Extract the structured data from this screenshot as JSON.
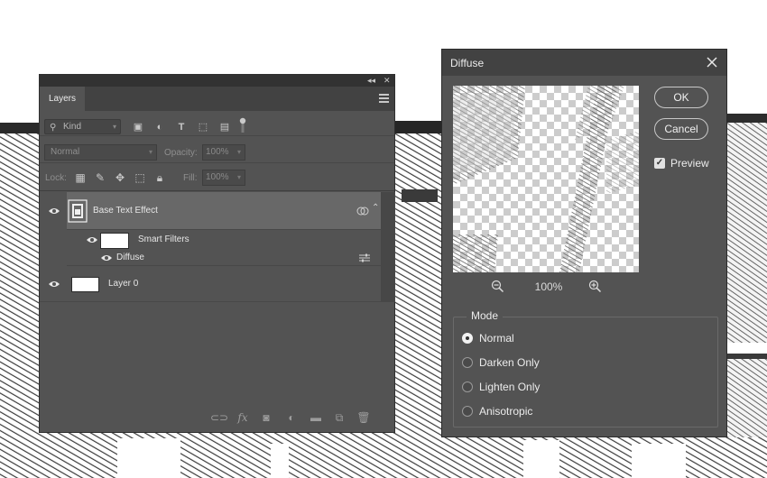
{
  "colors": {
    "panel_bg": "#535353",
    "panel_dark": "#424242",
    "selected_row": "#686868",
    "text": "#e6e6e6",
    "muted": "#8e8e8e"
  },
  "layers_panel": {
    "tab_label": "Layers",
    "filter": {
      "kind_label": "Kind",
      "icons": [
        "image-filter-icon",
        "adjustment-filter-icon",
        "type-filter-icon",
        "shape-filter-icon",
        "smart-object-filter-icon"
      ]
    },
    "blend_mode": "Normal",
    "opacity_label": "Opacity:",
    "opacity_value": "100%",
    "lock_label": "Lock:",
    "fill_label": "Fill:",
    "fill_value": "100%",
    "layers": [
      {
        "name": "Base Text Effect",
        "type": "smart-object",
        "selected": true,
        "filters_label": "Smart Filters",
        "filters": [
          {
            "name": "Diffuse"
          }
        ]
      },
      {
        "name": "Layer 0",
        "type": "normal",
        "selected": false
      }
    ],
    "bottom_icons": [
      "link-icon",
      "fx-icon",
      "mask-icon",
      "adjustment-icon",
      "folder-icon",
      "new-layer-icon",
      "trash-icon"
    ],
    "bottom_fx_label": "fx"
  },
  "dialog": {
    "title": "Diffuse",
    "ok_label": "OK",
    "cancel_label": "Cancel",
    "preview_label": "Preview",
    "preview_checked": true,
    "zoom_value": "100%",
    "mode": {
      "legend": "Mode",
      "options": [
        "Normal",
        "Darken Only",
        "Lighten Only",
        "Anisotropic"
      ],
      "selected": "Normal"
    }
  }
}
